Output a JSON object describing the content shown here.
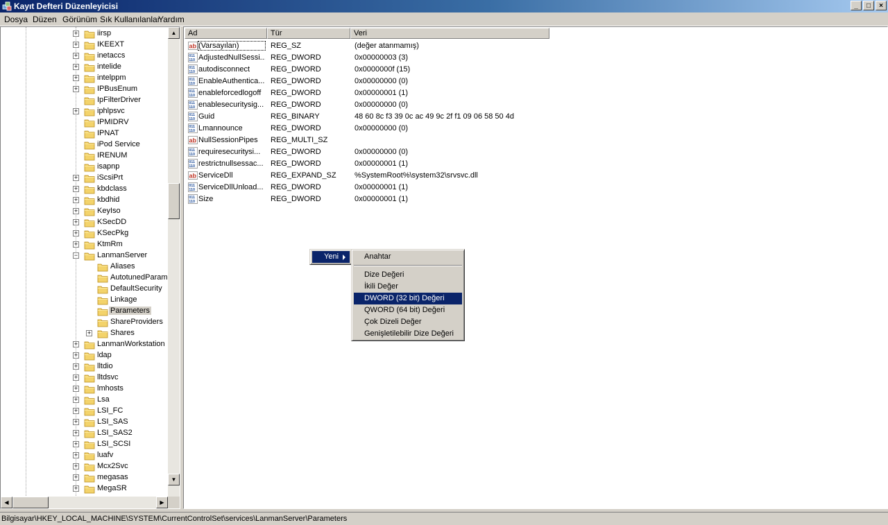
{
  "window": {
    "title": "Kayıt Defteri Düzenleyicisi",
    "buttons": {
      "minimize": "_",
      "maximize": "□",
      "close": "×"
    }
  },
  "menu": [
    "Dosya",
    "Düzen",
    "Görünüm",
    "Sık Kullanılanlar",
    "Yardım"
  ],
  "tree": {
    "items": [
      {
        "label": "iirsp",
        "expander": "+"
      },
      {
        "label": "IKEEXT",
        "expander": "+"
      },
      {
        "label": "inetaccs",
        "expander": "+"
      },
      {
        "label": "intelide",
        "expander": "+"
      },
      {
        "label": "intelppm",
        "expander": "+"
      },
      {
        "label": "IPBusEnum",
        "expander": "+"
      },
      {
        "label": "IpFilterDriver",
        "expander": ""
      },
      {
        "label": "iphlpsvc",
        "expander": "+"
      },
      {
        "label": "IPMIDRV",
        "expander": ""
      },
      {
        "label": "IPNAT",
        "expander": ""
      },
      {
        "label": "iPod Service",
        "expander": ""
      },
      {
        "label": "IRENUM",
        "expander": ""
      },
      {
        "label": "isapnp",
        "expander": ""
      },
      {
        "label": "iScsiPrt",
        "expander": "+"
      },
      {
        "label": "kbdclass",
        "expander": "+"
      },
      {
        "label": "kbdhid",
        "expander": "+"
      },
      {
        "label": "KeyIso",
        "expander": "+"
      },
      {
        "label": "KSecDD",
        "expander": "+"
      },
      {
        "label": "KSecPkg",
        "expander": "+"
      },
      {
        "label": "KtmRm",
        "expander": "+"
      },
      {
        "label": "LanmanServer",
        "expander": "−"
      },
      {
        "label": "Aliases",
        "expander": "",
        "child": true
      },
      {
        "label": "AutotunedParameters",
        "expander": "",
        "child": true
      },
      {
        "label": "DefaultSecurity",
        "expander": "",
        "child": true
      },
      {
        "label": "Linkage",
        "expander": "",
        "child": true
      },
      {
        "label": "Parameters",
        "expander": "",
        "child": true,
        "selected": true
      },
      {
        "label": "ShareProviders",
        "expander": "",
        "child": true
      },
      {
        "label": "Shares",
        "expander": "+",
        "child": true
      },
      {
        "label": "LanmanWorkstation",
        "expander": "+"
      },
      {
        "label": "ldap",
        "expander": "+"
      },
      {
        "label": "lltdio",
        "expander": "+"
      },
      {
        "label": "lltdsvc",
        "expander": "+"
      },
      {
        "label": "lmhosts",
        "expander": "+"
      },
      {
        "label": "Lsa",
        "expander": "+"
      },
      {
        "label": "LSI_FC",
        "expander": "+"
      },
      {
        "label": "LSI_SAS",
        "expander": "+"
      },
      {
        "label": "LSI_SAS2",
        "expander": "+"
      },
      {
        "label": "LSI_SCSI",
        "expander": "+"
      },
      {
        "label": "luafv",
        "expander": "+"
      },
      {
        "label": "Mcx2Svc",
        "expander": "+"
      },
      {
        "label": "megasas",
        "expander": "+"
      },
      {
        "label": "MegaSR",
        "expander": "+"
      }
    ]
  },
  "columns": {
    "name": "Ad",
    "type": "Tür",
    "data": "Veri"
  },
  "values": [
    {
      "name": "(Varsayılan)",
      "type": "REG_SZ",
      "data": "(değer atanmamış)",
      "icon": "string"
    },
    {
      "name": "AdjustedNullSessi...",
      "type": "REG_DWORD",
      "data": "0x00000003 (3)",
      "icon": "binary"
    },
    {
      "name": "autodisconnect",
      "type": "REG_DWORD",
      "data": "0x0000000f (15)",
      "icon": "binary"
    },
    {
      "name": "EnableAuthentica...",
      "type": "REG_DWORD",
      "data": "0x00000000 (0)",
      "icon": "binary"
    },
    {
      "name": "enableforcedlogoff",
      "type": "REG_DWORD",
      "data": "0x00000001 (1)",
      "icon": "binary"
    },
    {
      "name": "enablesecuritysig...",
      "type": "REG_DWORD",
      "data": "0x00000000 (0)",
      "icon": "binary"
    },
    {
      "name": "Guid",
      "type": "REG_BINARY",
      "data": "48 60 8c f3 39 0c ac 49 9c 2f f1 09 06 58 50 4d",
      "icon": "binary"
    },
    {
      "name": "Lmannounce",
      "type": "REG_DWORD",
      "data": "0x00000000 (0)",
      "icon": "binary"
    },
    {
      "name": "NullSessionPipes",
      "type": "REG_MULTI_SZ",
      "data": "",
      "icon": "string"
    },
    {
      "name": "requiresecuritysi...",
      "type": "REG_DWORD",
      "data": "0x00000000 (0)",
      "icon": "binary"
    },
    {
      "name": "restrictnullsessac...",
      "type": "REG_DWORD",
      "data": "0x00000001 (1)",
      "icon": "binary"
    },
    {
      "name": "ServiceDll",
      "type": "REG_EXPAND_SZ",
      "data": "%SystemRoot%\\system32\\srvsvc.dll",
      "icon": "string"
    },
    {
      "name": "ServiceDllUnload...",
      "type": "REG_DWORD",
      "data": "0x00000001 (1)",
      "icon": "binary"
    },
    {
      "name": "Size",
      "type": "REG_DWORD",
      "data": "0x00000001 (1)",
      "icon": "binary"
    }
  ],
  "context_menu": {
    "root": "Yeni",
    "submenu": {
      "key": "Anahtar",
      "items": [
        {
          "label": "Dize Değeri"
        },
        {
          "label": "İkili Değer"
        },
        {
          "label": "DWORD (32 bit) Değeri",
          "highlighted": true
        },
        {
          "label": "QWORD (64 bit) Değeri"
        },
        {
          "label": "Çok Dizeli Değer"
        },
        {
          "label": "Genişletilebilir Dize Değeri"
        }
      ]
    }
  },
  "status": "Bilgisayar\\HKEY_LOCAL_MACHINE\\SYSTEM\\CurrentControlSet\\services\\LanmanServer\\Parameters",
  "colors": {
    "highlight": "#0a246a",
    "face": "#d4d0c8",
    "folder": "#f3d36b"
  }
}
